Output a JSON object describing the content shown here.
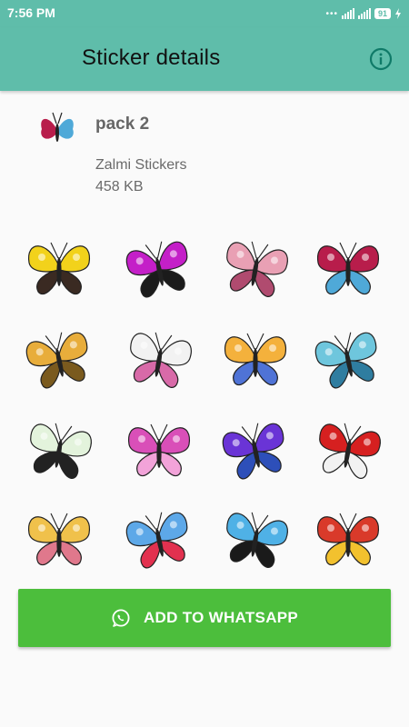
{
  "status_bar": {
    "time": "7:56 PM",
    "battery": "91"
  },
  "app_bar": {
    "title": "Sticker details",
    "info_icon": "info-icon"
  },
  "pack": {
    "name": "pack 2",
    "publisher": "Zalmi Stickers",
    "size": "458 KB"
  },
  "stickers": [
    {
      "name": "sticker-1",
      "colors": [
        "#f2d21b",
        "#3a2a22"
      ]
    },
    {
      "name": "sticker-2",
      "colors": [
        "#c41fc8",
        "#1b1b1b"
      ]
    },
    {
      "name": "sticker-3",
      "colors": [
        "#e9a0b4",
        "#b04b6f"
      ]
    },
    {
      "name": "sticker-4",
      "colors": [
        "#b81d4b",
        "#4fa9d8"
      ]
    },
    {
      "name": "sticker-5",
      "colors": [
        "#e8ad3b",
        "#7a5a1e"
      ]
    },
    {
      "name": "sticker-6",
      "colors": [
        "#f2f2f2",
        "#d86aa8"
      ]
    },
    {
      "name": "sticker-7",
      "colors": [
        "#f4b13c",
        "#4f73d6"
      ]
    },
    {
      "name": "sticker-8",
      "colors": [
        "#6ec6dd",
        "#2f7da0"
      ]
    },
    {
      "name": "sticker-9",
      "colors": [
        "#e3f3dc",
        "#222222"
      ]
    },
    {
      "name": "sticker-10",
      "colors": [
        "#d94fb8",
        "#f2a3d9"
      ]
    },
    {
      "name": "sticker-11",
      "colors": [
        "#6a34d6",
        "#2d4fb9"
      ]
    },
    {
      "name": "sticker-12",
      "colors": [
        "#d62020",
        "#f2f2f2"
      ]
    },
    {
      "name": "sticker-13",
      "colors": [
        "#f0c14b",
        "#e0788c"
      ]
    },
    {
      "name": "sticker-14",
      "colors": [
        "#5da8e8",
        "#e2314f"
      ]
    },
    {
      "name": "sticker-15",
      "colors": [
        "#4fb1e6",
        "#1a1a1a"
      ]
    },
    {
      "name": "sticker-16",
      "colors": [
        "#d93a2a",
        "#f2c12e"
      ]
    }
  ],
  "add_button": {
    "label": "ADD TO WHATSAPP",
    "icon": "whatsapp-icon"
  },
  "colors": {
    "accent": "#5fbdaa",
    "button": "#4cbe3c"
  }
}
